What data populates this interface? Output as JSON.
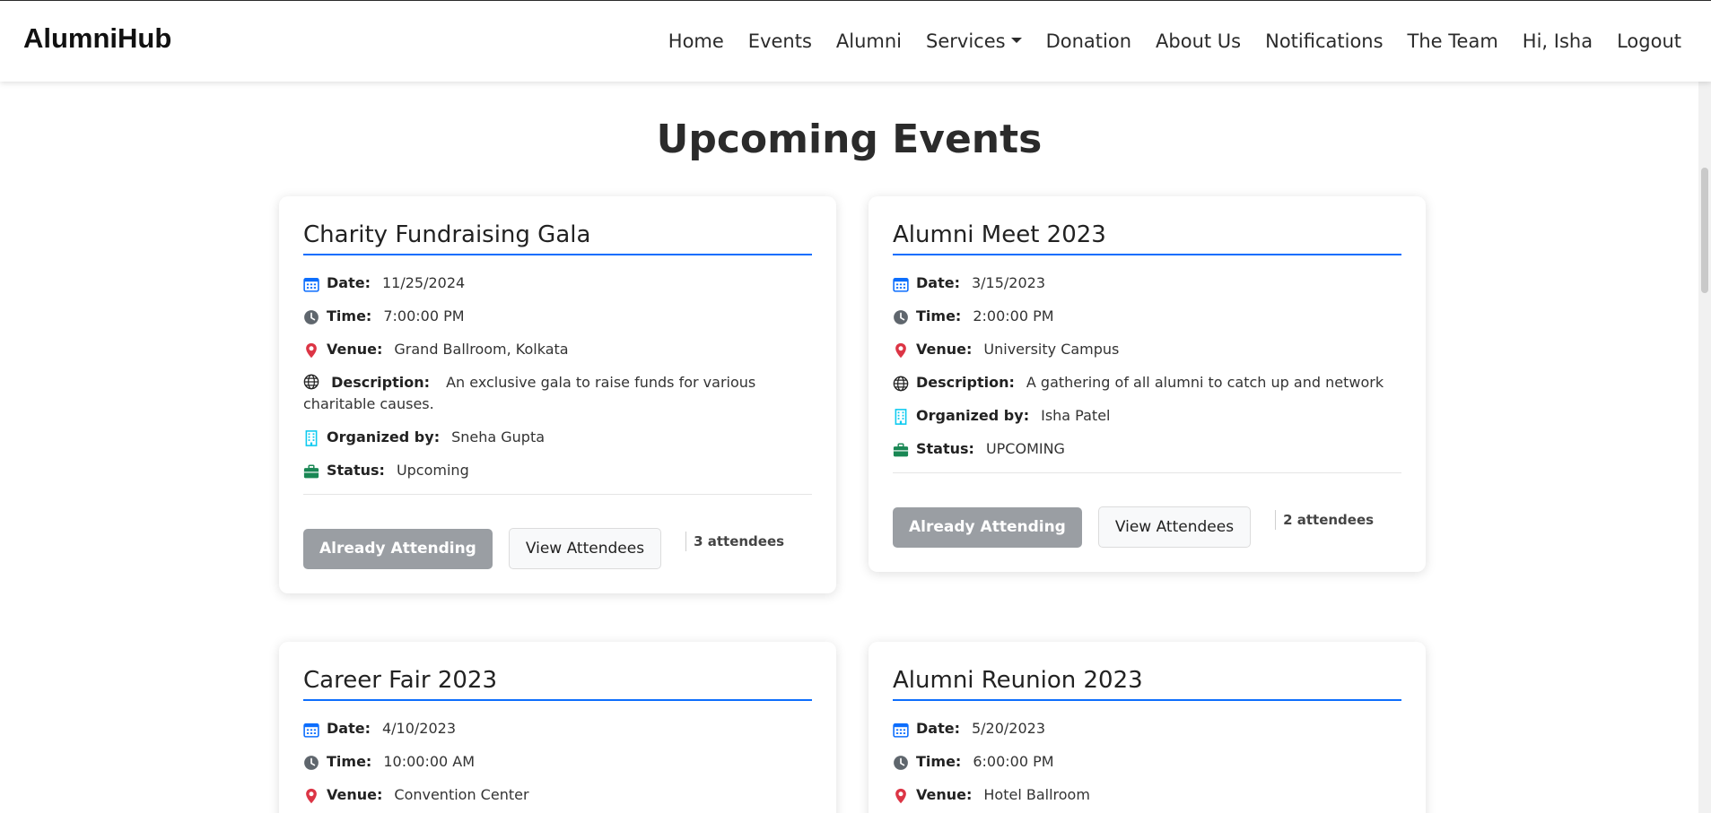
{
  "brand": "AlumniHub",
  "nav": {
    "home": "Home",
    "events": "Events",
    "alumni": "Alumni",
    "services": "Services",
    "donation": "Donation",
    "about": "About Us",
    "notifications": "Notifications",
    "team": "The Team",
    "greeting": "Hi, Isha",
    "logout": "Logout"
  },
  "page_title": "Upcoming Events",
  "labels": {
    "date": "Date:",
    "time": "Time:",
    "venue": "Venue:",
    "description": "Description:",
    "organized_by": "Organized by:",
    "status": "Status:"
  },
  "buttons": {
    "attending": "Already Attending",
    "view_attendees": "View Attendees"
  },
  "events": [
    {
      "title": "Charity Fundraising Gala",
      "date": "11/25/2024",
      "time": "7:00:00 PM",
      "venue": "Grand Ballroom, Kolkata",
      "description": "An exclusive gala to raise funds for various charitable causes.",
      "organizer": "Sneha Gupta",
      "status": "Upcoming",
      "attendees": "3 attendees"
    },
    {
      "title": "Alumni Meet 2023",
      "date": "3/15/2023",
      "time": "2:00:00 PM",
      "venue": "University Campus",
      "description": "A gathering of all alumni to catch up and network",
      "organizer": "Isha Patel",
      "status": "UPCOMING",
      "attendees": "2 attendees"
    },
    {
      "title": "Career Fair 2023",
      "date": "4/10/2023",
      "time": "10:00:00 AM",
      "venue": "Convention Center"
    },
    {
      "title": "Alumni Reunion 2023",
      "date": "5/20/2023",
      "time": "6:00:00 PM",
      "venue": "Hotel Ballroom"
    }
  ],
  "colors": {
    "accent": "#0d6efd",
    "calendar_icon": "#0d6efd",
    "clock_icon": "#6c757d",
    "pin_icon": "#dc3545",
    "building_icon": "#0dcaf0",
    "briefcase_icon": "#198754",
    "attending_button": "#9a9ea3"
  },
  "icons": [
    "calendar-icon",
    "clock-icon",
    "map-pin-icon",
    "globe-icon",
    "building-icon",
    "briefcase-icon"
  ]
}
